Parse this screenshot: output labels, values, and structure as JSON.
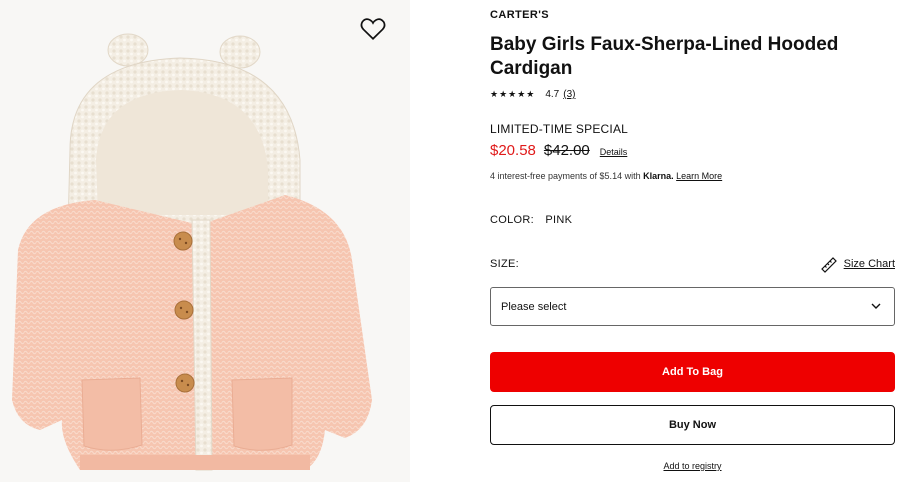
{
  "product": {
    "brand": "CARTER'S",
    "title": "Baby Girls Faux-Sherpa-Lined Hooded Cardigan",
    "image_alt_icon": "product-image",
    "rating": {
      "stars": "★★★★★",
      "value": 4.7,
      "value_text": "4.7",
      "count_text": "(3)"
    }
  },
  "pricing": {
    "deal_label": "LIMITED-TIME SPECIAL",
    "sale_price": "$20.58",
    "original_price": "$42.00",
    "details_link": "Details",
    "installments": {
      "prefix": "4 interest-free payments of $5.14 with",
      "provider": "Klarna.",
      "link": "Learn More"
    }
  },
  "options": {
    "color_label": "COLOR:",
    "color_value": "PINK",
    "size_label": "SIZE:",
    "size_chart_link": "Size Chart",
    "size_select_value": "Please select"
  },
  "actions": {
    "add_to_bag": "Add To Bag",
    "buy_now": "Buy Now",
    "add_to_registry": "Add to registry"
  },
  "colors": {
    "accent_red": "#ee0000",
    "sale_red": "#e01a1a",
    "cardigan_pink": "#f7c9b5",
    "sherpa": "#f3ede3"
  },
  "icons": [
    "heart-icon",
    "ruler-icon",
    "chevron-down-icon",
    "star-icon"
  ]
}
